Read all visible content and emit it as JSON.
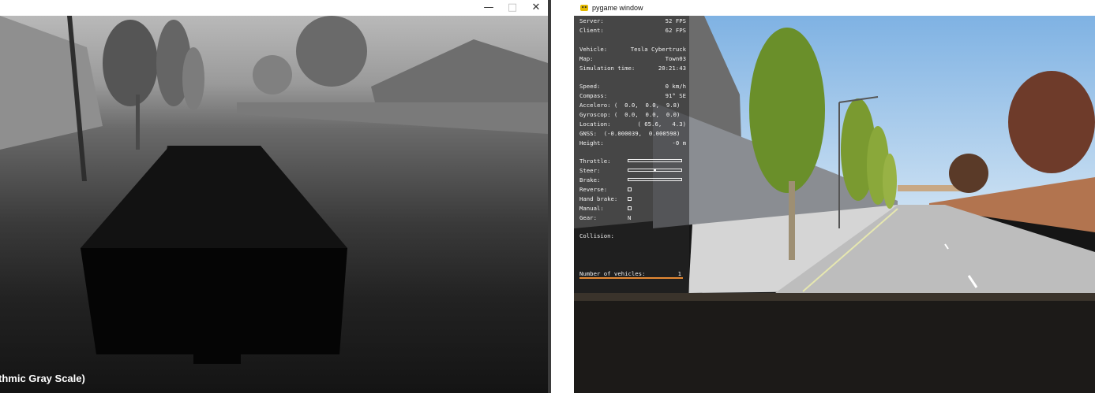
{
  "left_window": {
    "controls": {
      "minimize": "—",
      "maximize": "□",
      "close": "✕"
    },
    "caption": "thmic Gray Scale)"
  },
  "right_window": {
    "title": "pygame window",
    "hud": {
      "lines": [
        {
          "label": "Server:",
          "value": "52 FPS"
        },
        {
          "label": "Client:",
          "value": "62 FPS"
        },
        {
          "label": "",
          "value": ""
        },
        {
          "label": "Vehicle:",
          "value": "Tesla Cybertruck"
        },
        {
          "label": "Map:",
          "value": "Town03"
        },
        {
          "label": "Simulation time:",
          "value": "20:21:43"
        },
        {
          "label": "",
          "value": ""
        },
        {
          "label": "Speed:",
          "value": "0 km/h"
        },
        {
          "label": "Compass:",
          "value": "91° SE"
        },
        {
          "label": "Accelero: (  0.0,  0.0,  9.8)",
          "value": ""
        },
        {
          "label": "Gyroscop: (  0.0,  0.0,  0.0)",
          "value": ""
        },
        {
          "label": "Location:",
          "value": "( 65.6,   4.3)"
        },
        {
          "label": "GNSS:  (-0.000039,  0.000598)",
          "value": ""
        },
        {
          "label": "Height:",
          "value": "-0 m"
        }
      ],
      "controls": [
        {
          "label": "Throttle:",
          "kind": "bar",
          "value": 0
        },
        {
          "label": "Steer:",
          "kind": "steer",
          "value": 0
        },
        {
          "label": "Brake:",
          "kind": "bar",
          "value": 0
        },
        {
          "label": "Reverse:",
          "kind": "check",
          "value": false
        },
        {
          "label": "Hand brake:",
          "kind": "check",
          "value": false
        },
        {
          "label": "Manual:",
          "kind": "check",
          "value": false
        },
        {
          "label": "Gear:",
          "kind": "text",
          "text": "N"
        }
      ],
      "collision_label": "Collision:",
      "vehicles_label": "Number of vehicles:",
      "vehicles_value": "1"
    }
  },
  "colors": {
    "hud_text": "#f2f2f2",
    "collision_bar": "#e58a34",
    "sky": "#9ec3e6",
    "road": "#bdbdbd"
  }
}
